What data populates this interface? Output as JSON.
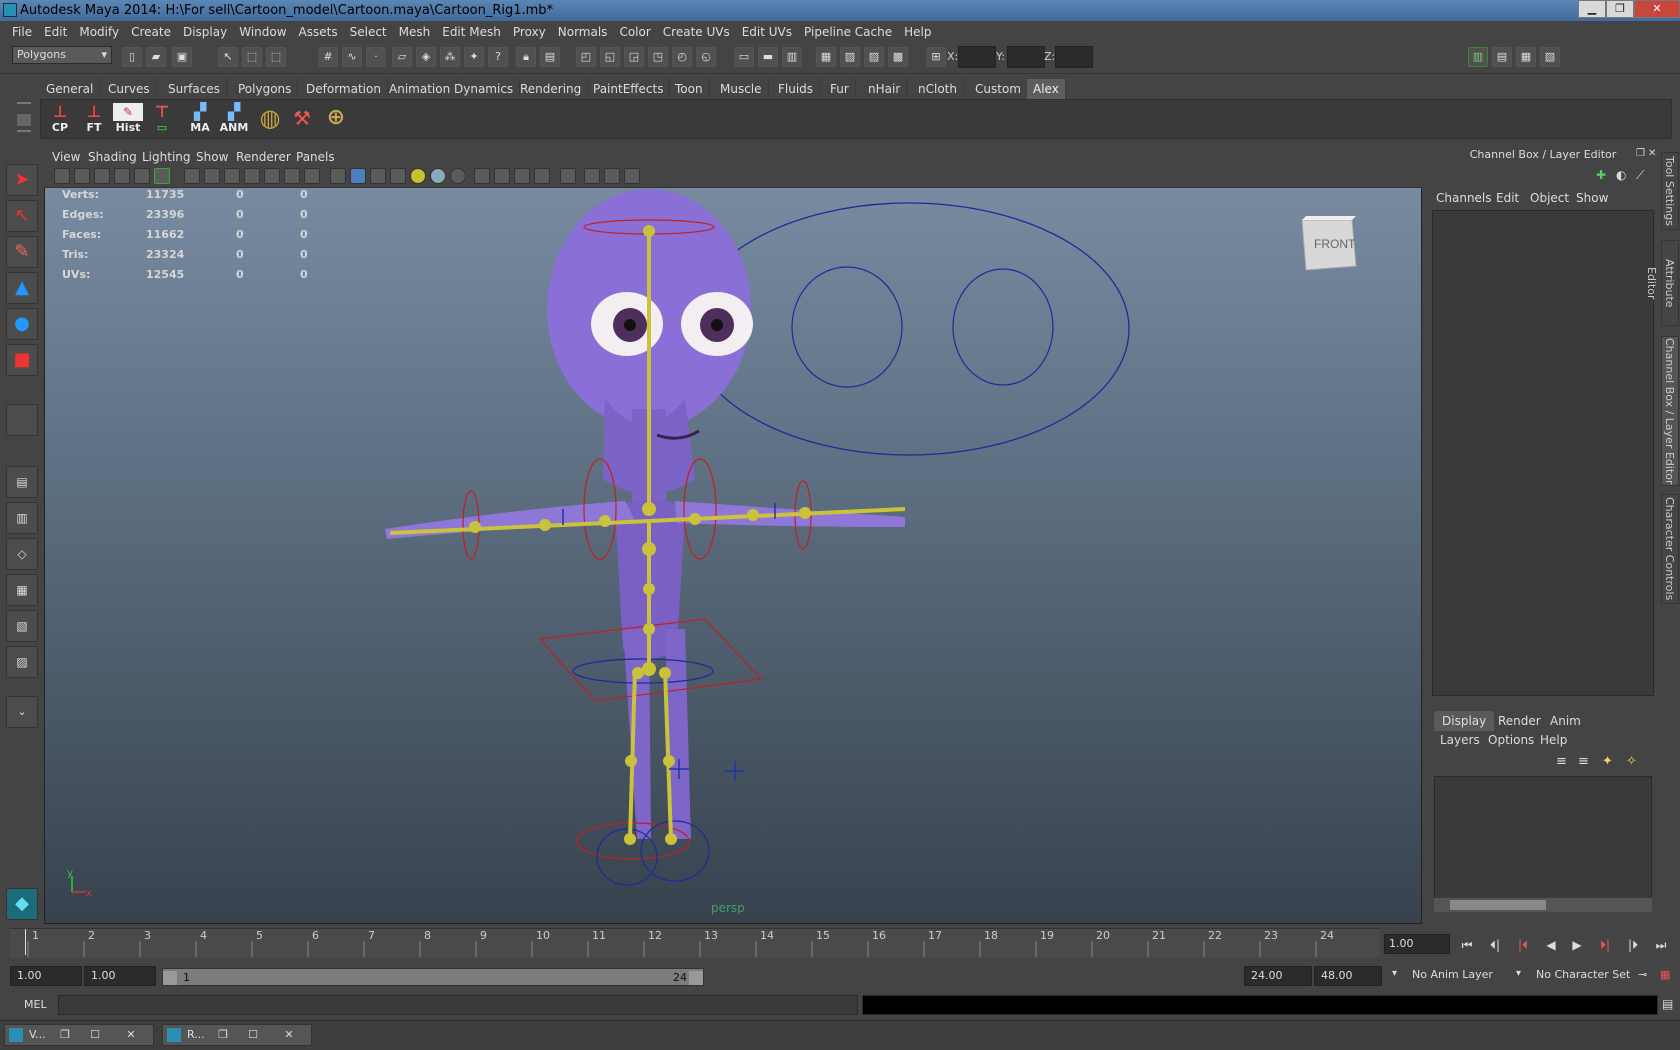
{
  "window": {
    "title": "Autodesk Maya 2014: H:\\For sell\\Cartoon_model\\Cartoon.maya\\Cartoon_Rig1.mb*",
    "min": "▁",
    "max": "❐",
    "close": "✕"
  },
  "menubar": [
    "File",
    "Edit",
    "Modify",
    "Create",
    "Display",
    "Window",
    "Assets",
    "Select",
    "Mesh",
    "Edit Mesh",
    "Proxy",
    "Normals",
    "Color",
    "Create UVs",
    "Edit UVs",
    "Pipeline Cache",
    "Help"
  ],
  "statusline": {
    "mode": "Polygons",
    "x_label": "X:",
    "y_label": "Y:",
    "z_label": "Z:"
  },
  "shelf_tabs": [
    "General",
    "Curves",
    "Surfaces",
    "Polygons",
    "Deformation",
    "Animation",
    "Dynamics",
    "Rendering",
    "PaintEffects",
    "Toon",
    "Muscle",
    "Fluids",
    "Fur",
    "nHair",
    "nCloth",
    "Custom",
    "Alex"
  ],
  "shelf_active_tab": "Alex",
  "shelf_buttons": [
    "CP",
    "FT",
    "Hist",
    "",
    "MA",
    "ANM",
    "",
    ""
  ],
  "viewport": {
    "menu": [
      "View",
      "Shading",
      "Lighting",
      "Show",
      "Renderer",
      "Panels"
    ],
    "camera": "persp",
    "viewcube": "FRONT",
    "axis_x": "x",
    "axis_y": "y",
    "hud": [
      {
        "label": "Verts:",
        "v1": "11735",
        "v2": "0",
        "v3": "0"
      },
      {
        "label": "Edges:",
        "v1": "23396",
        "v2": "0",
        "v3": "0"
      },
      {
        "label": "Faces:",
        "v1": "11662",
        "v2": "0",
        "v3": "0"
      },
      {
        "label": "Tris:",
        "v1": "23324",
        "v2": "0",
        "v3": "0"
      },
      {
        "label": "UVs:",
        "v1": "12545",
        "v2": "0",
        "v3": "0"
      }
    ]
  },
  "channel_box": {
    "title": "Channel Box / Layer Editor",
    "menu": [
      "Channels",
      "Edit",
      "Object",
      "Show"
    ]
  },
  "side_tabs": [
    "Tool Settings",
    "Attribute Editor",
    "Channel Box / Layer Editor",
    "Character Controls"
  ],
  "layer_editor": {
    "tabs": [
      "Display",
      "Render",
      "Anim"
    ],
    "menu": [
      "Layers",
      "Options",
      "Help"
    ]
  },
  "timeline": {
    "ticks": [
      "1",
      "2",
      "3",
      "4",
      "5",
      "6",
      "7",
      "8",
      "9",
      "10",
      "11",
      "12",
      "13",
      "14",
      "15",
      "16",
      "17",
      "18",
      "19",
      "20",
      "21",
      "22",
      "23",
      "24"
    ],
    "current_frame": "1.00"
  },
  "range": {
    "start": "1.00",
    "playback_start": "1.00",
    "slider_start": "1",
    "slider_end": "24",
    "playback_end": "24.00",
    "end": "48.00",
    "anim_layer": "No Anim Layer",
    "character_set": "No Character Set"
  },
  "command_line": {
    "label": "MEL"
  },
  "taskbar": [
    {
      "label": "V..."
    },
    {
      "label": "R..."
    }
  ]
}
